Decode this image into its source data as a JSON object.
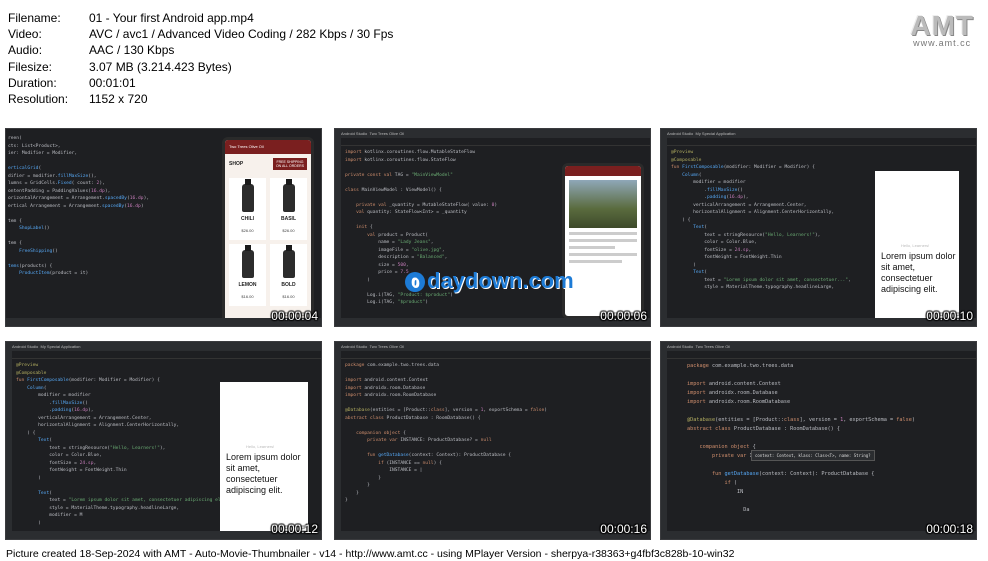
{
  "info": {
    "filename_label": "Filename:",
    "filename": "01 - Your first Android app.mp4",
    "video_label": "Video:",
    "video": "AVC / avc1 / Advanced Video Coding / 282 Kbps / 30 Fps",
    "audio_label": "Audio:",
    "audio": "AAC / 130 Kbps",
    "filesize_label": "Filesize:",
    "filesize": "3.07 MB (3.214.423 Bytes)",
    "duration_label": "Duration:",
    "duration": "00:01:01",
    "resolution_label": "Resolution:",
    "resolution": "1152 x 720"
  },
  "logo": {
    "text": "AMT",
    "url": "www.amt.cc"
  },
  "watermark": {
    "icon": "0",
    "text": "daydown.com"
  },
  "thumbs": [
    {
      "timestamp": "00:00:04",
      "app": "Two Trees Olive Oil",
      "section": "SHOP",
      "promo": "FREE SHIPPING ON ALL ORDERS",
      "products": [
        {
          "name": "CHILI",
          "price": "$26.00"
        },
        {
          "name": "BASIL",
          "price": "$26.00"
        },
        {
          "name": "LEMON",
          "price": "$16.00"
        },
        {
          "name": "BOLD",
          "price": "$16.00"
        }
      ]
    },
    {
      "timestamp": "00:00:06",
      "title": "Android Studio",
      "project": "Two Trees Olive Oil"
    },
    {
      "timestamp": "00:00:10",
      "title": "Android Studio",
      "project": "My Special Application",
      "preview_text": "Lorem ipsum dolor sit amet, consectetuer adipiscing elit.",
      "preview_hint": "Hello, Learners!"
    },
    {
      "timestamp": "00:00:12",
      "title": "Android Studio",
      "project": "My Special Application",
      "preview_text": "Lorem ipsum dolor sit amet, consectetuer adipiscing elit.",
      "preview_hint": "Hello, Learners!"
    },
    {
      "timestamp": "00:00:16",
      "title": "Android Studio",
      "project": "Two Trees Olive Oil"
    },
    {
      "timestamp": "00:00:18",
      "title": "Android Studio",
      "project": "Two Trees Olive Oil",
      "popup": "context: Context, klass: Class<T>, name: String?"
    }
  ],
  "footer": "Picture created 18-Sep-2024 with AMT - Auto-Movie-Thumbnailer - v14 - http://www.amt.cc - using MPlayer Version - sherpya-r38363+g4fbf3c828b-10-win32"
}
